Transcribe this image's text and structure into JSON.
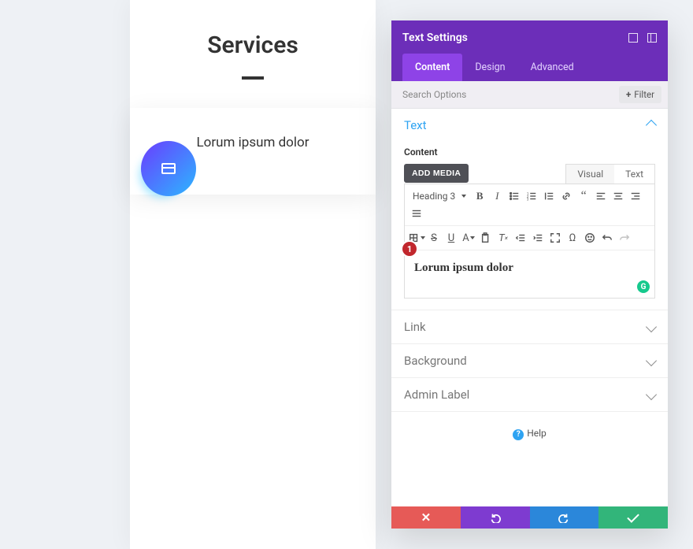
{
  "preview": {
    "title": "Services",
    "card_text": "Lorum ipsum dolor",
    "icon_name": "card-icon"
  },
  "panel": {
    "title": "Text Settings",
    "tabs": {
      "content": "Content",
      "design": "Design",
      "advanced": "Advanced",
      "active": "content"
    },
    "search_placeholder": "Search Options",
    "filter_label": "Filter"
  },
  "sections": {
    "text": {
      "label": "Text",
      "open": true,
      "content_label": "Content"
    },
    "link": {
      "label": "Link"
    },
    "background": {
      "label": "Background"
    },
    "admin_label": {
      "label": "Admin Label"
    }
  },
  "wysiwyg": {
    "add_media": "ADD MEDIA",
    "visual_tab": "Visual",
    "text_tab": "Text",
    "format_selector": "Heading 3",
    "content": "Lorum ipsum dolor",
    "badge_number": "1"
  },
  "help": {
    "label": "Help"
  }
}
